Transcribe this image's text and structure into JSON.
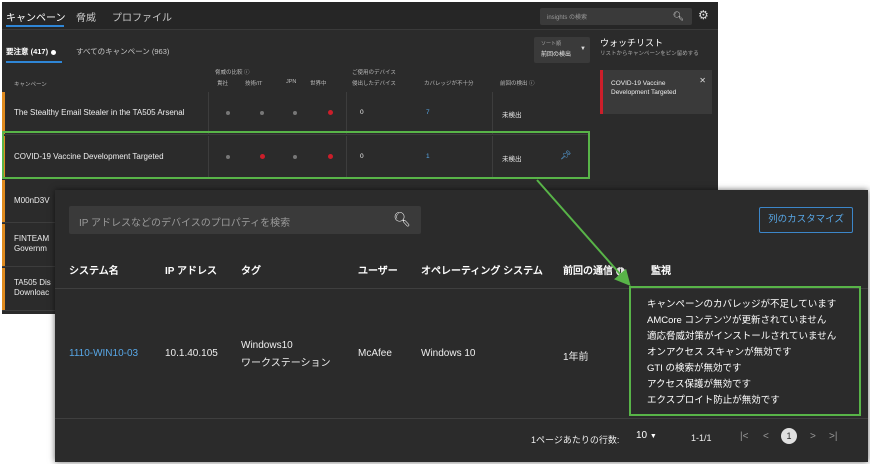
{
  "top_nav": {
    "tabs": [
      "キャンペーン",
      "脅威",
      "プロファイル"
    ],
    "search_placeholder": "insights の検索"
  },
  "campaign_tabs": {
    "attention": "要注意 (417)",
    "all": "すべてのキャンペーン (963)"
  },
  "sort": {
    "label": "ソート順",
    "value": "前回の検出"
  },
  "table_headers": {
    "campaign": "キャンペーン",
    "threat_compare": "脅威の比較",
    "industry": "貴社",
    "tech": "技術/IT",
    "jpn": "JPN",
    "global": "世界中",
    "device_title": "ご使用のデバイス",
    "detected_devices": "侵出したデバイス",
    "coverage_low": "カバレッジが不十分",
    "last_detected": "前回の検出"
  },
  "campaigns": [
    {
      "name": "The Stealthy Email Stealer in the TA505 Arsenal",
      "detected": "0",
      "coverage": "7",
      "last": "未検出"
    },
    {
      "name": "COVID-19 Vaccine Development Targeted",
      "detected": "0",
      "coverage": "1",
      "last": "未検出"
    },
    {
      "name": "M00nD3V"
    },
    {
      "name": "FINTEAM",
      "name2": "Governm"
    },
    {
      "name": "TA505 Dis",
      "name2": "Downloac"
    }
  ],
  "watchlist": {
    "title": "ウォッチリスト",
    "subtitle": "リストからキャンペーンをピン留めする",
    "card": "COVID-19 Vaccine Development Targeted"
  },
  "devices": {
    "search_placeholder": "IP アドレスなどのデバイスのプロパティを検索",
    "customize_button": "列のカスタマイズ",
    "headers": {
      "system": "システム名",
      "ip": "IP アドレス",
      "tag": "タグ",
      "user": "ユーザー",
      "os": "オペレーティング システム",
      "last_comm": "前回の通信",
      "monitor": "監視"
    },
    "row": {
      "system": "1110-WIN10-03",
      "ip": "10.1.40.105",
      "tag1": "Windows10",
      "tag2": "ワークステーション",
      "user": "McAfee",
      "os": "Windows 10",
      "last_comm": "1年前"
    },
    "monitor_items": [
      "キャンペーンのカバレッジが不足しています",
      "AMCore コンテンツが更新されていません",
      "適応脅威対策がインストールされていません",
      "オンアクセス スキャンが無効です",
      "GTI の検索が無効です",
      "アクセス保護が無効です",
      "エクスプロイト防止が無効です"
    ],
    "pager": {
      "rows_label": "1ページあたりの行数:",
      "rows_value": "10",
      "range": "1-1/1",
      "current_page": "1"
    }
  },
  "colors": {
    "highlight": "#58b448",
    "accent_blue": "#58a8e8",
    "severity_red": "#cc1e2a",
    "stripe_orange": "#e08b1f"
  }
}
